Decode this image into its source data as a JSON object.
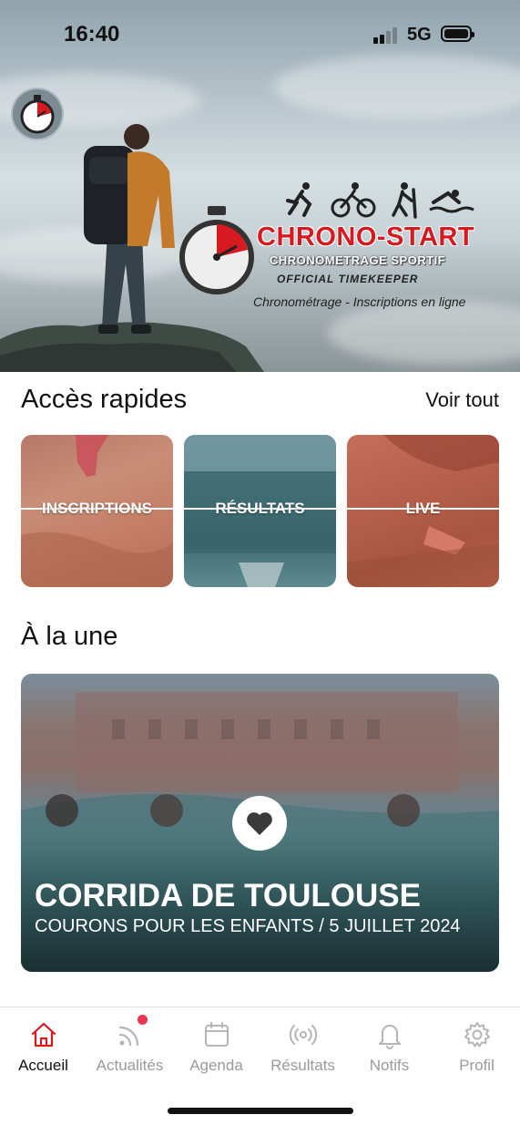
{
  "status_bar": {
    "time": "16:40",
    "network": "5G"
  },
  "hero": {
    "brand_title": "CHRONO-START",
    "brand_subtitle": "CHRONOMETRAGE SPORTIF",
    "brand_official": "OFFICIAL TIMEKEEPER",
    "brand_tagline": "Chronométrage - Inscriptions en ligne",
    "sport_icons": [
      "running-icon",
      "cycling-icon",
      "hiking-icon",
      "swimming-icon"
    ]
  },
  "quick_access": {
    "title": "Accès rapides",
    "see_all": "Voir tout",
    "tiles": [
      {
        "label": "INSCRIPTIONS"
      },
      {
        "label": "RÉSULTATS"
      },
      {
        "label": "LIVE"
      }
    ]
  },
  "featured": {
    "title": "À la une",
    "card_title": "CORRIDA DE TOULOUSE",
    "card_subtitle": "COURONS POUR LES ENFANTS / 5 JUILLET 2024"
  },
  "tabbar": {
    "items": [
      {
        "label": "Accueil",
        "icon": "home-icon",
        "active": true
      },
      {
        "label": "Actualités",
        "icon": "rss-icon",
        "badge": true
      },
      {
        "label": "Agenda",
        "icon": "calendar-icon"
      },
      {
        "label": "Résultats",
        "icon": "broadcast-icon"
      },
      {
        "label": "Notifs",
        "icon": "bell-icon"
      },
      {
        "label": "Profil",
        "icon": "gear-icon"
      }
    ]
  },
  "colors": {
    "accent": "#d71920",
    "badge": "#e8364f",
    "tab_inactive": "#9a9a9a"
  }
}
